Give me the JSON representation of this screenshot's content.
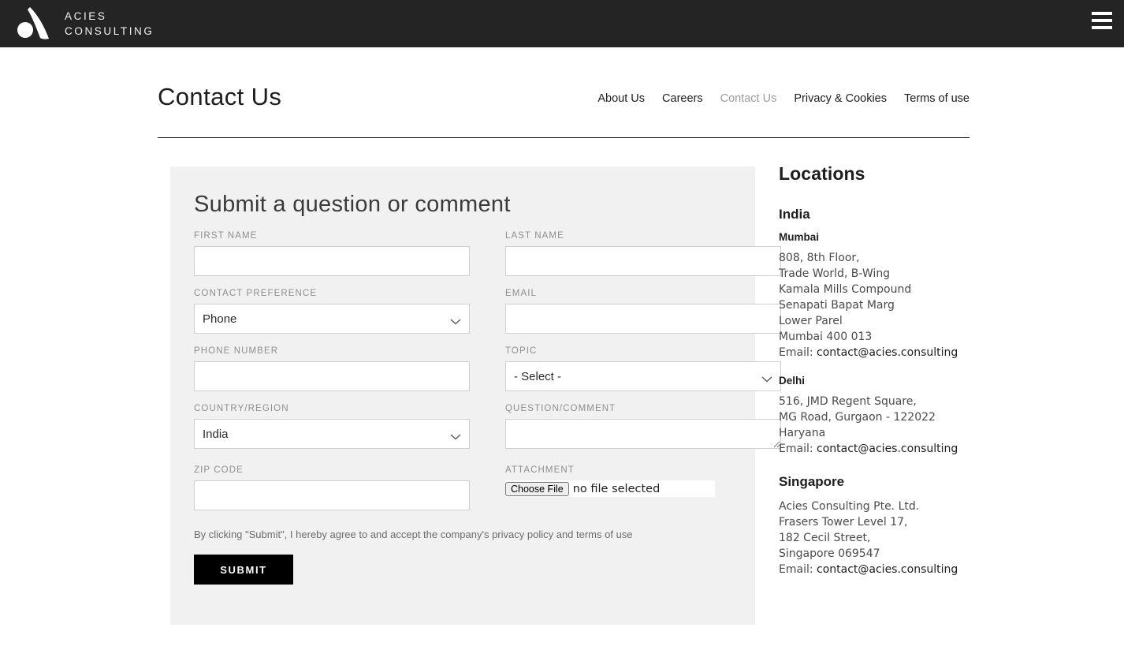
{
  "topbar": {
    "brand_line1": "ACIES",
    "brand_line2": "CONSULTING",
    "logo_icon": "acies-logo-mark",
    "menu_icon": "hamburger-menu-icon"
  },
  "header": {
    "title": "Contact Us",
    "nav": [
      {
        "label": "About Us",
        "current": false
      },
      {
        "label": "Careers",
        "current": false
      },
      {
        "label": "Contact Us",
        "current": true
      },
      {
        "label": "Privacy & Cookies",
        "current": false
      },
      {
        "label": "Terms of use",
        "current": false
      }
    ]
  },
  "form": {
    "title": "Submit a question or comment",
    "first_name": {
      "label": "FIRST NAME",
      "value": ""
    },
    "last_name": {
      "label": "LAST NAME",
      "value": ""
    },
    "contact_preference": {
      "label": "CONTACT PREFERENCE",
      "value": "Phone"
    },
    "email": {
      "label": "EMAIL",
      "value": ""
    },
    "phone_number": {
      "label": "PHONE NUMBER",
      "value": ""
    },
    "topic": {
      "label": "TOPIC",
      "value": "- Select -"
    },
    "country_region": {
      "label": "COUNTRY/REGION",
      "value": "India"
    },
    "question_comment": {
      "label": "QUESTION/COMMENT",
      "value": ""
    },
    "zip_code": {
      "label": "ZIP CODE",
      "value": ""
    },
    "attachment": {
      "label": "ATTACHMENT",
      "button_label": "Choose File",
      "status": "no file selected"
    },
    "disclaimer": "By clicking \"Submit\", I hereby agree to and accept the company's privacy policy and terms of use",
    "submit_label": "SUBMIT",
    "chevron_icon": "chevron-down-icon"
  },
  "locations": {
    "title": "Locations",
    "groups": [
      {
        "country": "India",
        "offices": [
          {
            "city": "Mumbai",
            "lines": [
              "808, 8th Floor,",
              "Trade World, B-Wing",
              "Kamala Mills Compound",
              "Senapati Bapat Marg",
              "Lower Parel",
              "Mumbai 400 013"
            ],
            "email_label": "Email:",
            "email": "contact@acies.consulting"
          },
          {
            "city": "Delhi",
            "lines": [
              "516, JMD Regent Square,",
              "MG Road, Gurgaon - 122022",
              "Haryana"
            ],
            "email_label": "Email:",
            "email": "contact@acies.consulting"
          }
        ]
      },
      {
        "country": "Singapore",
        "offices": [
          {
            "city": "",
            "lines": [
              "Acies Consulting Pte. Ltd.",
              "Frasers Tower Level 17,",
              "182 Cecil Street,",
              "Singapore 069547"
            ],
            "email_label": "Email:",
            "email": "contact@acies.consulting"
          }
        ]
      }
    ]
  },
  "colors": {
    "topbar_bg": "#242424",
    "panel_bg": "#f1f1f1",
    "submit_bg": "#000000",
    "label_text": "#8e8e8e",
    "nav_active": "#9b9b9b"
  }
}
